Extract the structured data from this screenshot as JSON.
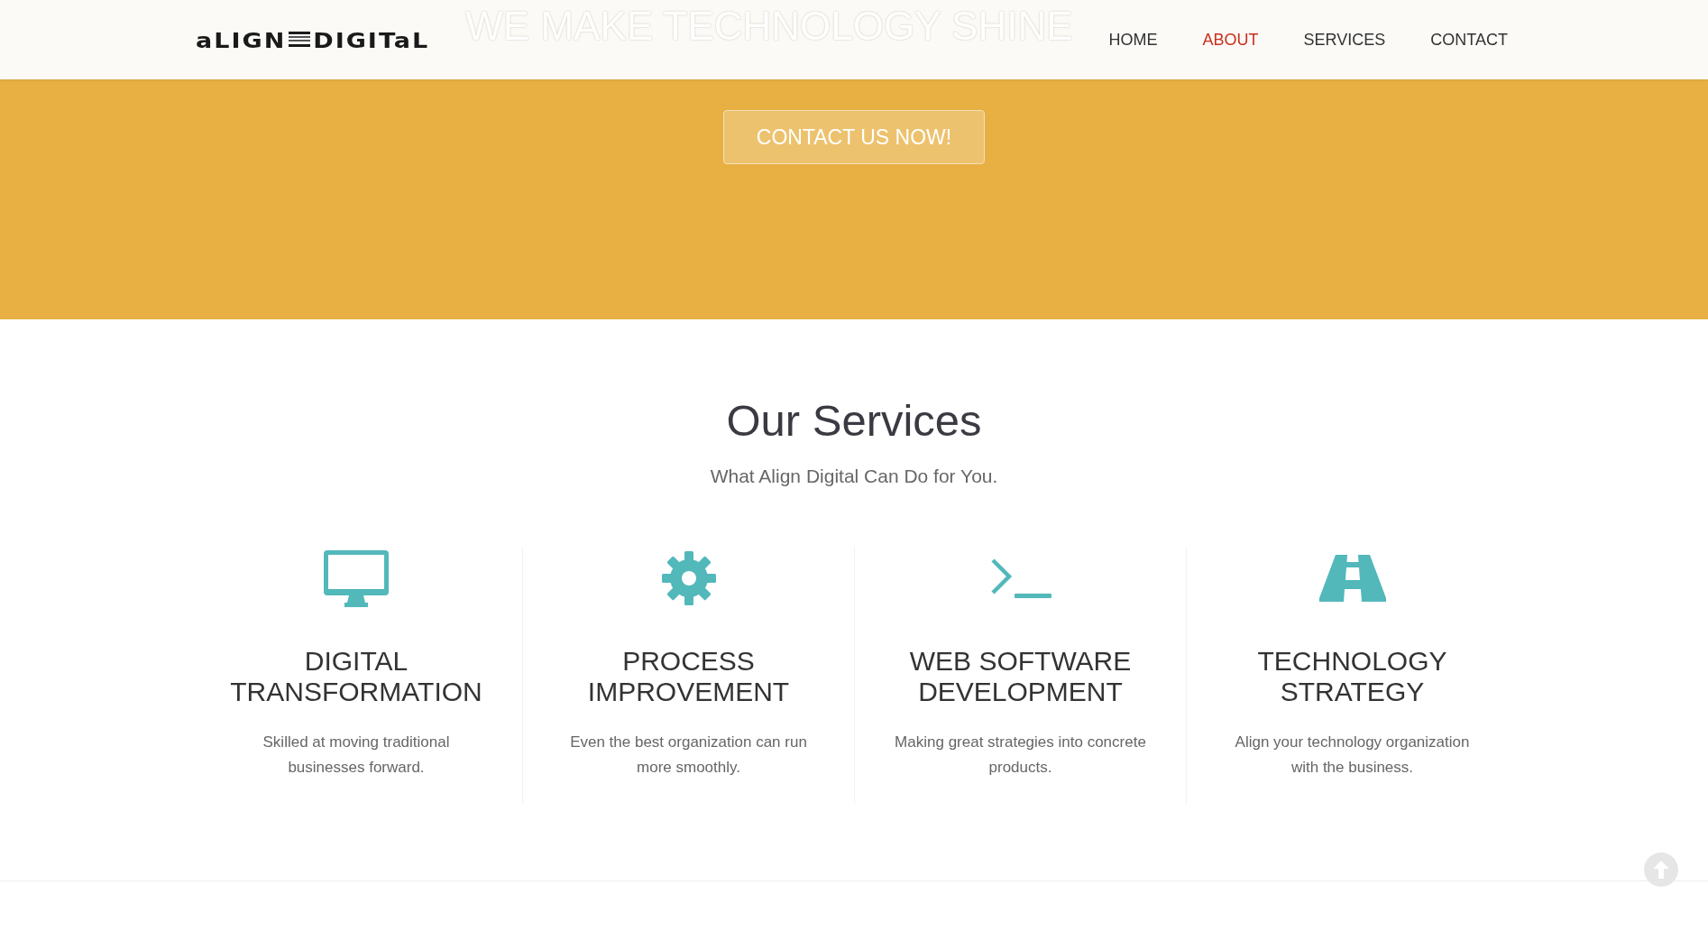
{
  "header": {
    "logo": {
      "left": "aLIGN",
      "right": "DIGITaL"
    },
    "nav": [
      {
        "label": "HOME",
        "selected": false
      },
      {
        "label": "ABOUT",
        "selected": true
      },
      {
        "label": "SERVICES",
        "selected": false
      },
      {
        "label": "CONTACT",
        "selected": false
      }
    ]
  },
  "hero": {
    "title": "WE MAKE TECHNOLOGY SHINE",
    "button": "CONTACT US NOW!"
  },
  "services": {
    "title": "Our Services",
    "subtitle": "What Align Digital Can Do for You.",
    "items": [
      {
        "kind": "monitor",
        "title": "DIGITAL TRANSFORMATION",
        "text": "Skilled at moving traditional businesses forward."
      },
      {
        "kind": "gear",
        "title": "PROCESS IMPROVEMENT",
        "text": "Even the best organization can run more smoothly."
      },
      {
        "kind": "terminal",
        "title": "WEB SOFTWARE DEVELOPMENT",
        "text": "Making great strategies into concrete products."
      },
      {
        "kind": "road",
        "title": "TECHNOLOGY STRATEGY",
        "text": "Align your technology organization with the business."
      }
    ]
  }
}
